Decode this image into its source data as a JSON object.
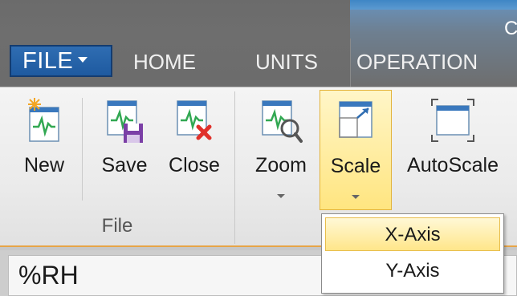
{
  "window": {
    "title_fragment": "C"
  },
  "tabs": {
    "file": "FILE",
    "items": [
      "HOME",
      "UNITS",
      "OPERATION"
    ]
  },
  "ribbon": {
    "file_group": {
      "label": "File",
      "buttons": [
        "New",
        "Save",
        "Close"
      ]
    },
    "view_group": {
      "buttons": [
        "Zoom",
        "Scale",
        "AutoScale"
      ]
    }
  },
  "scale_menu": {
    "items": [
      "X-Axis",
      "Y-Axis"
    ]
  },
  "panel": {
    "label": "%RH"
  },
  "colors": {
    "file_tab": "#1e5aa0",
    "accent": "#ffe580",
    "dropdown_hover": "#ffe68a"
  }
}
